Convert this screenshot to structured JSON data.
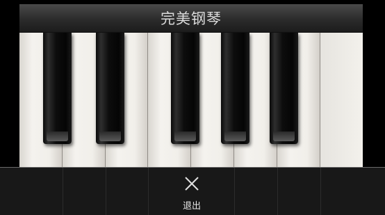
{
  "app": {
    "title": "完美钢琴"
  },
  "keyboard": {
    "white_keys": 8,
    "black_keys": 5
  },
  "exit": {
    "label": "退出",
    "icon": "close-icon"
  },
  "colors": {
    "title_bar": "#2b2b2b",
    "title_text": "#dcdcdc",
    "overlay": "#1a1a1a",
    "label": "#e8e8e8"
  }
}
